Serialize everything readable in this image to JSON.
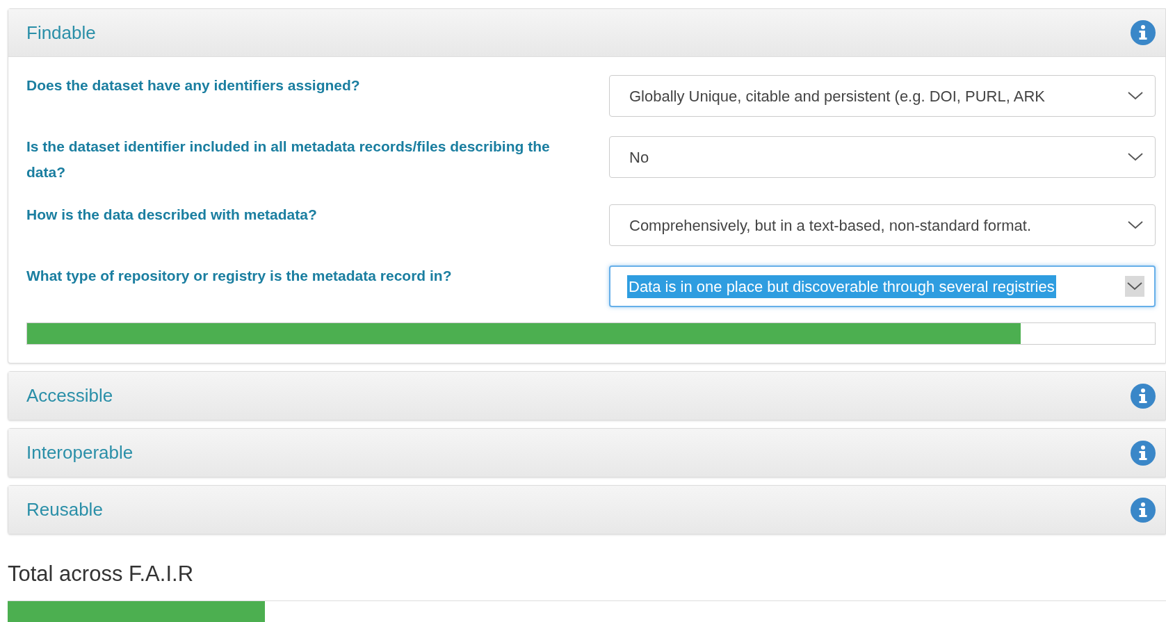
{
  "sections": [
    {
      "title": "Findable",
      "expanded": true,
      "questions": [
        {
          "label": "Does the dataset have any identifiers assigned?",
          "value": "Globally Unique, citable and persistent (e.g. DOI, PURL, ARK",
          "focused": false
        },
        {
          "label": "Is the dataset identifier included in all metadata records/files describing the data?",
          "value": "No",
          "focused": false
        },
        {
          "label": "How is the data described with metadata?",
          "value": "Comprehensively, but in a text-based, non-standard format.",
          "focused": false
        },
        {
          "label": "What type of repository or registry is the metadata record in?",
          "value": "Data is in one place but discoverable through several registries",
          "focused": true
        }
      ],
      "level": 0.881
    },
    {
      "title": "Accessible",
      "expanded": false
    },
    {
      "title": "Interoperable",
      "expanded": false
    },
    {
      "title": "Reusable",
      "expanded": false
    }
  ],
  "total": {
    "title": "Total across F.A.I.R",
    "level": 0.222
  }
}
